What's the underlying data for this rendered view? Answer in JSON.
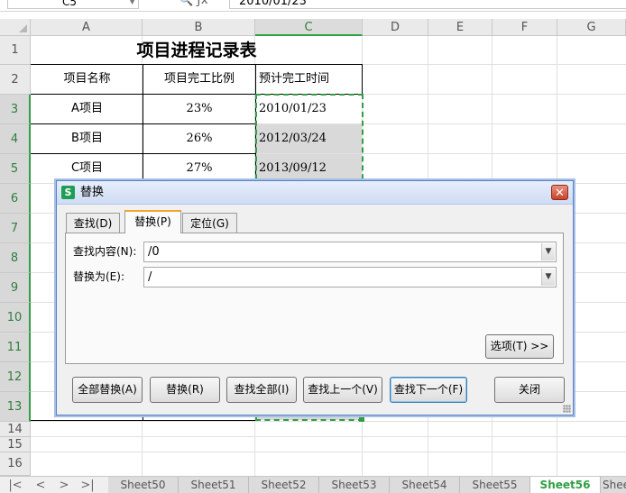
{
  "formula_bar": {
    "cell_ref": "C5",
    "fx_icon": "fx-icon",
    "content": "2010/01/23"
  },
  "columns": [
    "A",
    "B",
    "C",
    "D",
    "E",
    "F",
    "G"
  ],
  "rows": [
    "1",
    "2",
    "3",
    "4",
    "5",
    "6",
    "7",
    "8",
    "9",
    "10",
    "11",
    "12",
    "13",
    "14",
    "15",
    "16"
  ],
  "sheet": {
    "title": "项目进程记录表",
    "headers": [
      "项目名称",
      "项目完工比例",
      "预计完工时间"
    ],
    "data": [
      [
        "A项目",
        "23%",
        "2010/01/23"
      ],
      [
        "B项目",
        "26%",
        "2012/03/24"
      ],
      [
        "C项目",
        "27%",
        "2013/09/12"
      ]
    ]
  },
  "sheet_tabs": {
    "nav": [
      "|<",
      "<",
      ">",
      ">|"
    ],
    "tabs": [
      "Sheet50",
      "Sheet51",
      "Sheet52",
      "Sheet53",
      "Sheet54",
      "Sheet55",
      "Sheet56",
      "Shee"
    ],
    "active": "Sheet56"
  },
  "dialog": {
    "title": "替换",
    "close": "✕",
    "logo": "S",
    "tabs": [
      "查找(D)",
      "替换(P)",
      "定位(G)"
    ],
    "active_tab": "替换(P)",
    "find_label": "查找内容(N):",
    "find_value": "/0",
    "replace_label": "替换为(E):",
    "replace_value": "/",
    "options_button": "选项(T) >>",
    "buttons": [
      "全部替换(A)",
      "替换(R)",
      "查找全部(I)",
      "查找上一个(V)",
      "查找下一个(F)",
      "关闭"
    ]
  },
  "colors": {
    "selection_green": "#2f9e44",
    "tab_accent": "#f3a531",
    "dialog_border": "#5a82c4",
    "close_red": "#c9432b"
  }
}
